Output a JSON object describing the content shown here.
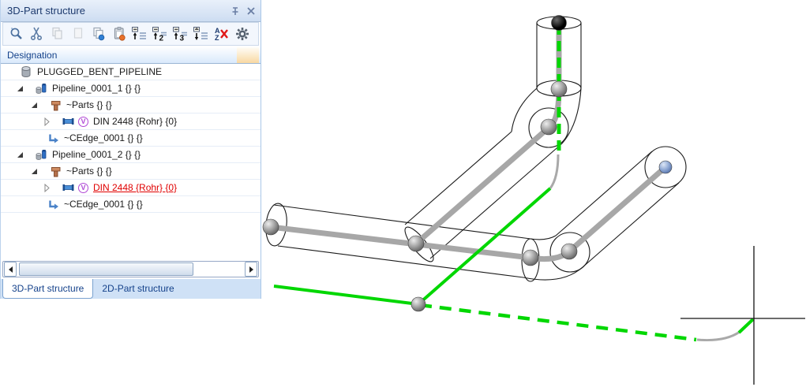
{
  "panel": {
    "title": "3D-Part structure",
    "column_header": "Designation",
    "toolbar": [
      {
        "name": "search-icon"
      },
      {
        "name": "cut-scissors-icon"
      },
      {
        "name": "copy-icon"
      },
      {
        "name": "paste-icon"
      },
      {
        "name": "copy-special-icon"
      },
      {
        "name": "paste-clipboard-icon"
      },
      {
        "name": "collapse-list-icon"
      },
      {
        "name": "expand-level-2-icon",
        "glyph": "2"
      },
      {
        "name": "expand-level-3-icon",
        "glyph": "3"
      },
      {
        "name": "expand-all-list-icon"
      },
      {
        "name": "remove-sort-icon",
        "letter_top": "A",
        "letter_bottom": "Z"
      },
      {
        "name": "settings-gear-icon"
      }
    ],
    "tree": [
      {
        "label": "PLUGGED_BENT_PIPELINE"
      },
      {
        "label": "Pipeline_0001_1 {} {}"
      },
      {
        "label": "~Parts {} {}"
      },
      {
        "label": "DIN 2448 {Rohr} {0}",
        "badge": "V"
      },
      {
        "label": "~CEdge_0001 {} {}"
      },
      {
        "label": "Pipeline_0001_2 {} {}"
      },
      {
        "label": "~Parts {} {}"
      },
      {
        "label": "DIN 2448 {Rohr} {0}",
        "badge": "V",
        "state": "highlighted-red"
      },
      {
        "label": "~CEdge_0001 {} {}"
      }
    ],
    "tabs": [
      {
        "label": "3D-Part structure",
        "active": true
      },
      {
        "label": "2D-Part structure",
        "active": false
      }
    ]
  },
  "viewport": {
    "background": "#ffffff",
    "wireframe_color": "#1a1a1a",
    "pipe_centerline_color": "#a7a7a7",
    "guideline_color": "#00d700",
    "bend_arc_color": "#a9a9a9",
    "plug_sphere_color": "#000000",
    "joint_sphere_color": "#9f9f9f",
    "endpoint_sphere_color": "#7d9ac9",
    "crosshair_color": "#141414"
  }
}
